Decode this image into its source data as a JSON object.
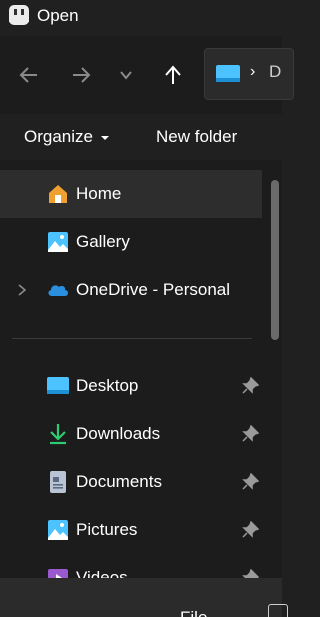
{
  "window": {
    "title": "Open"
  },
  "toolbar": {
    "organize_label": "Organize",
    "new_folder_label": "New folder"
  },
  "address": {
    "separator": "›",
    "next_segment": "D"
  },
  "nav": {
    "items": [
      {
        "label": "Home",
        "icon": "home-icon",
        "selected": true
      },
      {
        "label": "Gallery",
        "icon": "gallery-icon"
      },
      {
        "label": "OneDrive - Personal",
        "icon": "onedrive-icon",
        "expandable": true
      },
      {
        "label": "Desktop",
        "icon": "desktop-icon",
        "pinned": true
      },
      {
        "label": "Downloads",
        "icon": "downloads-icon",
        "pinned": true
      },
      {
        "label": "Documents",
        "icon": "documents-icon",
        "pinned": true
      },
      {
        "label": "Pictures",
        "icon": "pictures-icon",
        "pinned": true
      },
      {
        "label": "Videos",
        "icon": "videos-icon",
        "pinned": true
      }
    ]
  },
  "bottom": {
    "text": "File"
  },
  "colors": {
    "background": "#202020",
    "pane": "#1c1c1c",
    "selected": "#2d2d2d",
    "accent": "#4cc2ff"
  }
}
